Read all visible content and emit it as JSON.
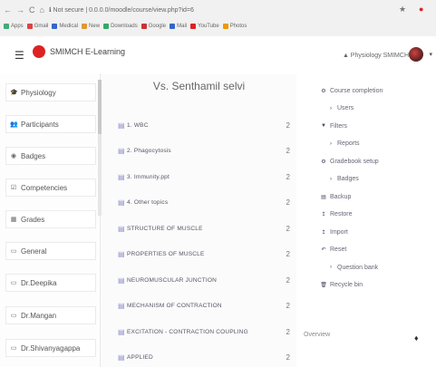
{
  "browser": {
    "nav_icons": [
      "back-icon",
      "forward-icon",
      "reload-icon",
      "home-icon"
    ],
    "url": "ℹ Not secure | 0.0.0.0/moodle/course/view.php?id=6",
    "bookmarks": [
      {
        "label": "Apps",
        "color": "#4a7"
      },
      {
        "label": "Gmail",
        "color": "#d44"
      },
      {
        "label": "Medical",
        "color": "#36c"
      },
      {
        "label": "New",
        "color": "#d93"
      },
      {
        "label": "Downloads",
        "color": "#3a6"
      },
      {
        "label": "Google",
        "color": "#c33"
      },
      {
        "label": "Mail",
        "color": "#36c"
      },
      {
        "label": "YouTube",
        "color": "#d22"
      },
      {
        "label": "Photos",
        "color": "#e90"
      }
    ]
  },
  "header": {
    "brand": "SMIMCH E-Learning",
    "user": "▲ Physiology SMIMCH"
  },
  "sidebar": {
    "items": [
      {
        "icon": "graduation-cap-icon",
        "glyph": "🎓",
        "label": "Physiology"
      },
      {
        "icon": "users-icon",
        "glyph": "👥",
        "label": "Participants"
      },
      {
        "icon": "badge-icon",
        "glyph": "◉",
        "label": "Badges"
      },
      {
        "icon": "competencies-icon",
        "glyph": "☑",
        "label": "Competencies"
      },
      {
        "icon": "grades-icon",
        "glyph": "▦",
        "label": "Grades"
      },
      {
        "icon": "folder-icon",
        "glyph": "▭",
        "label": "General"
      },
      {
        "icon": "folder-icon",
        "glyph": "▭",
        "label": "Dr.Deepika"
      },
      {
        "icon": "folder-icon",
        "glyph": "▭",
        "label": "Dr.Mangan"
      },
      {
        "icon": "folder-icon",
        "glyph": "▭",
        "label": "Dr.Shivanyagappa"
      }
    ]
  },
  "main": {
    "course_title": "Vs. Senthamil selvi",
    "activities": [
      {
        "label": "1. WBC",
        "count": "2"
      },
      {
        "label": "2. Phagocytosis",
        "count": "2"
      },
      {
        "label": "3. Immunity.ppt",
        "count": "2"
      },
      {
        "label": "4. Other topics",
        "count": "2"
      },
      {
        "label": "STRUCTURE OF MUSCLE",
        "count": "2"
      },
      {
        "label": "PROPERTIES OF MUSCLE",
        "count": "2"
      },
      {
        "label": "NEUROMUSCULAR JUNCTION",
        "count": "2"
      },
      {
        "label": "MECHANISM OF CONTRACTION",
        "count": "2"
      },
      {
        "label": "EXCITATION - CONTRACTION COUPLING",
        "count": "2"
      },
      {
        "label": "APPLIED",
        "count": "2"
      }
    ]
  },
  "admin": {
    "items": [
      {
        "label": "Course completion",
        "icon": "gear-icon",
        "glyph": "⚙",
        "sub": false
      },
      {
        "label": "Users",
        "icon": "chevron-right-icon",
        "glyph": "›",
        "sub": true
      },
      {
        "label": "Filters",
        "icon": "filter-icon",
        "glyph": "▼",
        "sub": false
      },
      {
        "label": "Reports",
        "icon": "chevron-right-icon",
        "glyph": "›",
        "sub": true
      },
      {
        "label": "Gradebook setup",
        "icon": "gear-icon",
        "glyph": "⚙",
        "sub": false
      },
      {
        "label": "Badges",
        "icon": "chevron-right-icon",
        "glyph": "›",
        "sub": true
      },
      {
        "label": "Backup",
        "icon": "backup-icon",
        "glyph": "▤",
        "sub": false
      },
      {
        "label": "Restore",
        "icon": "restore-icon",
        "glyph": "↥",
        "sub": false
      },
      {
        "label": "Import",
        "icon": "import-icon",
        "glyph": "↥",
        "sub": false
      },
      {
        "label": "Reset",
        "icon": "reset-icon",
        "glyph": "↶",
        "sub": false
      },
      {
        "label": "Question bank",
        "icon": "chevron-right-icon",
        "glyph": "›",
        "sub": true
      },
      {
        "label": "Recycle bin",
        "icon": "trash-icon",
        "glyph": "🗑",
        "sub": false
      }
    ],
    "footer": "Overview"
  }
}
